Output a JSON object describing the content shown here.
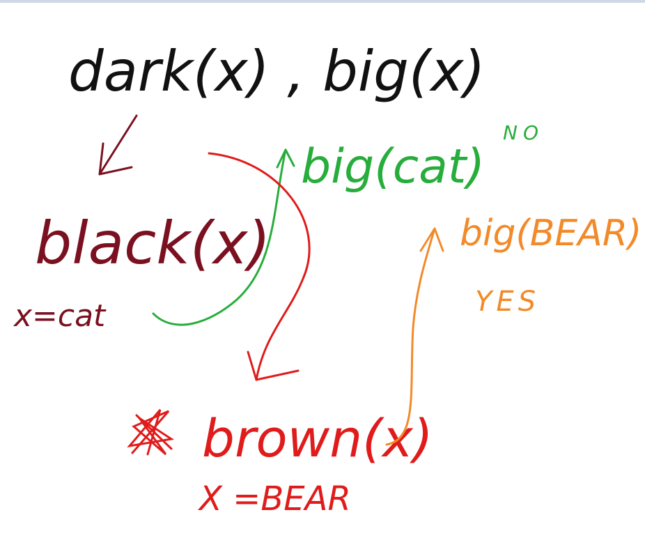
{
  "colors": {
    "black": "#111111",
    "dark_red": "#7a1020",
    "red": "#e01b1b",
    "green": "#27ad3b",
    "orange": "#f28a2a",
    "top_bar": "#cfd8e6"
  },
  "texts": {
    "query": "dark(x) , big(x)",
    "black": "black(x)",
    "x_cat": "x=cat",
    "big_cat": "big(cat)",
    "no": "NO",
    "big_bear": "big(BEAR)",
    "yes": "YES",
    "brown": "brown(x)",
    "x_bear": "X =BEAR"
  }
}
